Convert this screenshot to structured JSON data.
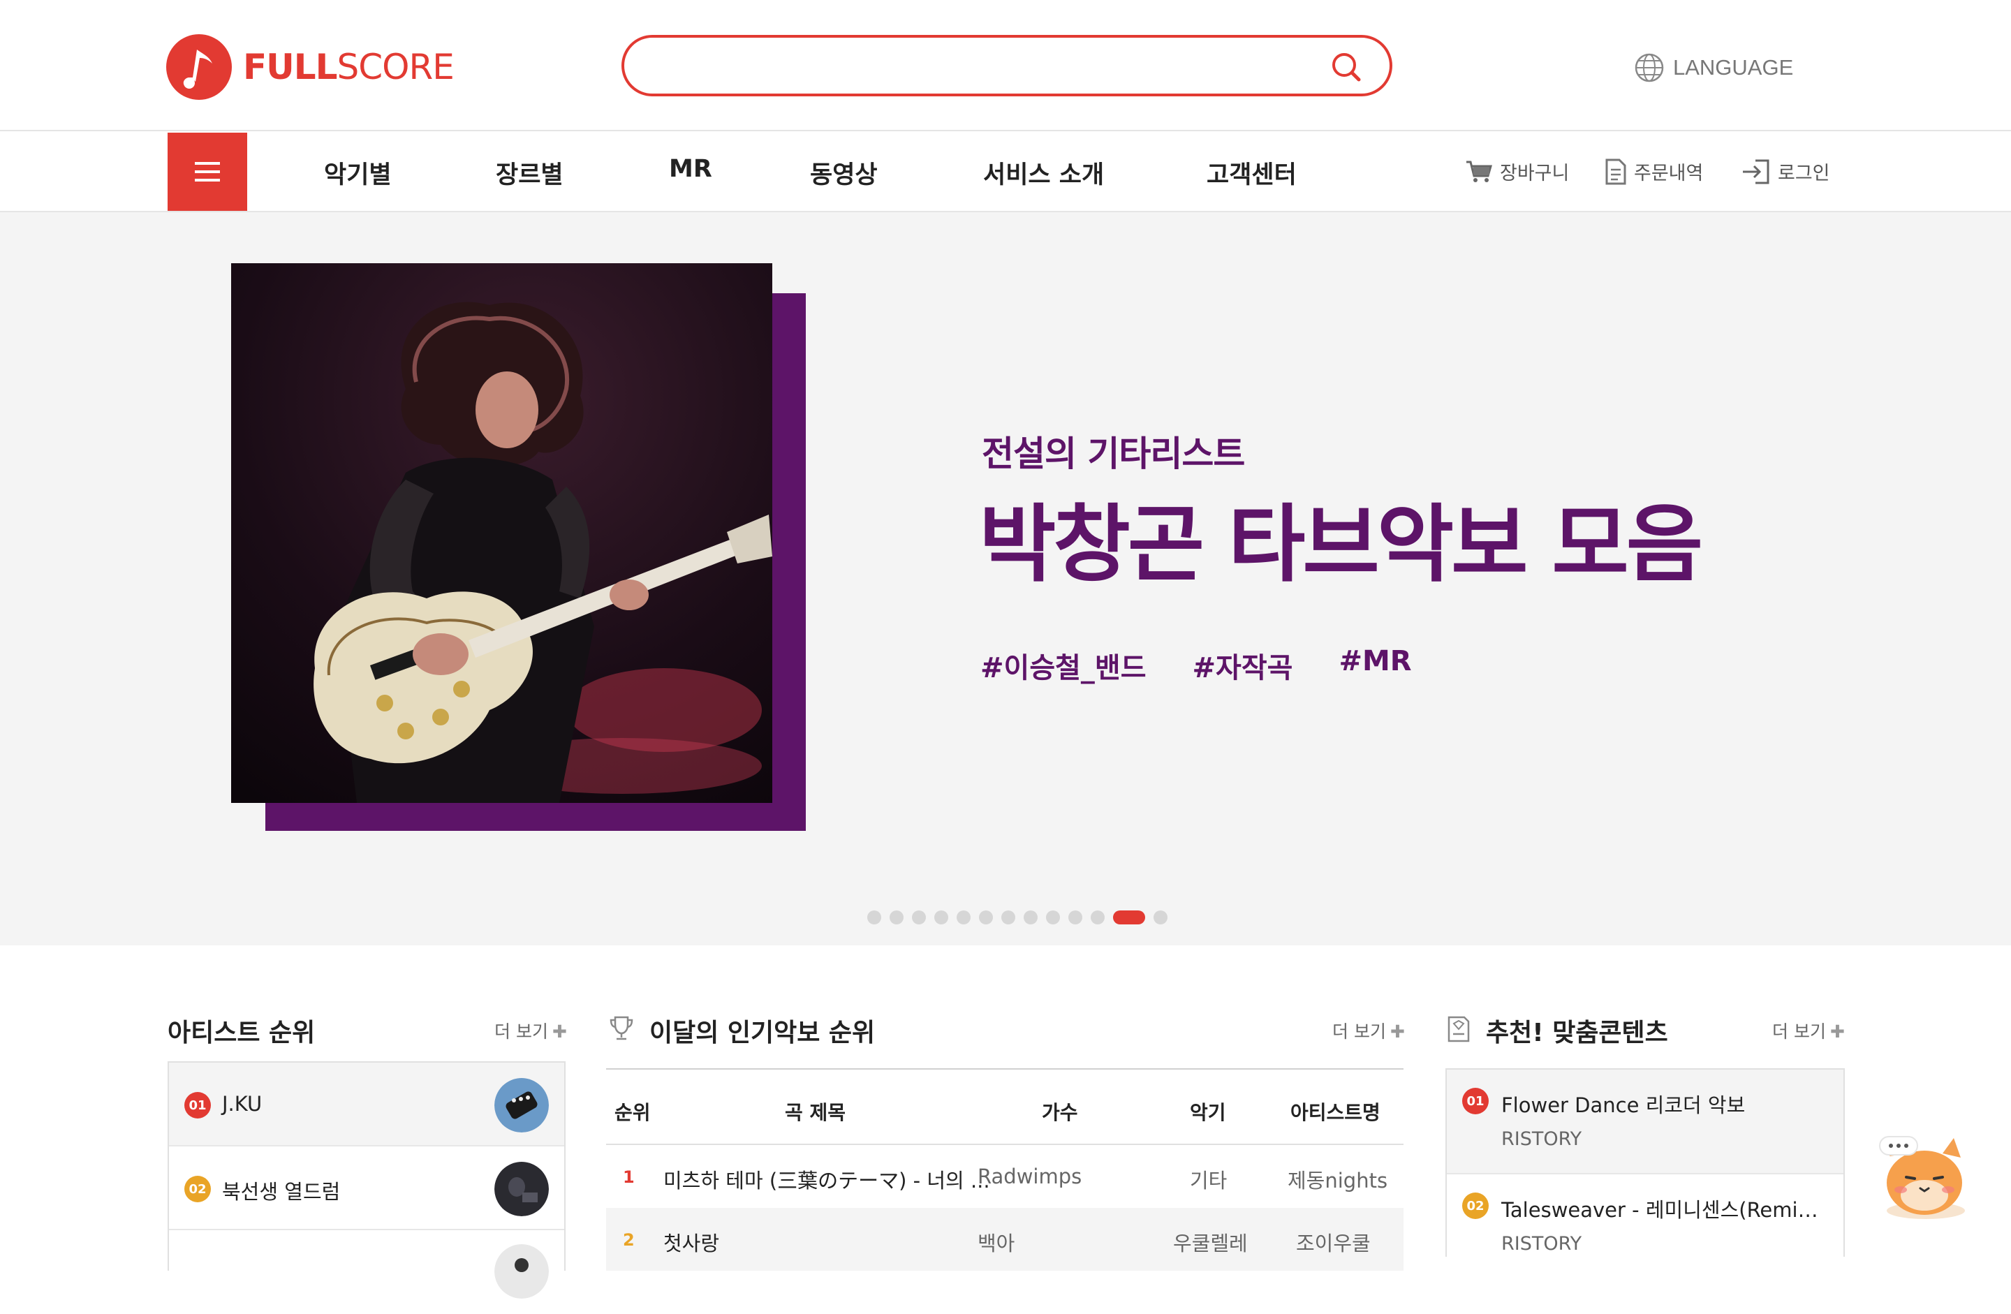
{
  "brand": {
    "name_part1": "FULL",
    "name_part2": "SCORE",
    "accent": "#e23a32",
    "hero_color": "#5d1468"
  },
  "search": {
    "value": "",
    "placeholder": ""
  },
  "language": {
    "label": "LANGUAGE"
  },
  "nav": {
    "items": [
      "악기별",
      "장르별",
      "MR",
      "동영상",
      "서비스 소개",
      "고객센터"
    ],
    "cart": "장바구니",
    "orders": "주문내역",
    "login": "로그인"
  },
  "hero": {
    "subtitle": "전설의 기타리스트",
    "title": "박창곤 타브악보 모음",
    "tags": [
      "#이승철_밴드",
      "#자작곡",
      "#MR"
    ],
    "slide_count": 13,
    "active_slide": 11
  },
  "artist_rank": {
    "title": "아티스트 순위",
    "more": "더 보기",
    "items": [
      {
        "rank": "01",
        "name": "J.KU",
        "badge_color": "#e23a32"
      },
      {
        "rank": "02",
        "name": "북선생 열드럼",
        "badge_color": "#e9a426"
      }
    ]
  },
  "chart": {
    "title": "이달의 인기악보 순위",
    "more": "더 보기",
    "headers": {
      "rank": "순위",
      "song": "곡 제목",
      "singer": "가수",
      "instrument": "악기",
      "artist": "아티스트명"
    },
    "rows": [
      {
        "rank": "1",
        "song": "미츠하 테마 (三葉のテーマ) - 너의 ...",
        "singer": "Radwimps",
        "instrument": "기타",
        "artist": "제동nights",
        "rank_color": "#e23a32"
      },
      {
        "rank": "2",
        "song": "첫사랑",
        "singer": "백아",
        "instrument": "우쿨렐레",
        "artist": "조이우쿨",
        "rank_color": "#e9a426"
      }
    ]
  },
  "recommend": {
    "title": "추천! 맞춤콘텐츠",
    "more": "더 보기",
    "items": [
      {
        "rank": "01",
        "title": "Flower Dance 리코더 악보",
        "sub": "RISTORY",
        "badge_color": "#e23a32"
      },
      {
        "rank": "02",
        "title": "Talesweaver - 레미니센스(Reminiscence)",
        "sub": "RISTORY",
        "badge_color": "#e9a426"
      }
    ]
  },
  "icons": {
    "search": "search-icon",
    "globe": "globe-icon",
    "cart": "cart-icon",
    "orders": "document-icon",
    "login": "login-icon",
    "menu": "menu-icon",
    "trophy": "trophy-icon",
    "recommend": "bookmark-doc-icon",
    "chatbot": "cat-mascot-icon"
  }
}
